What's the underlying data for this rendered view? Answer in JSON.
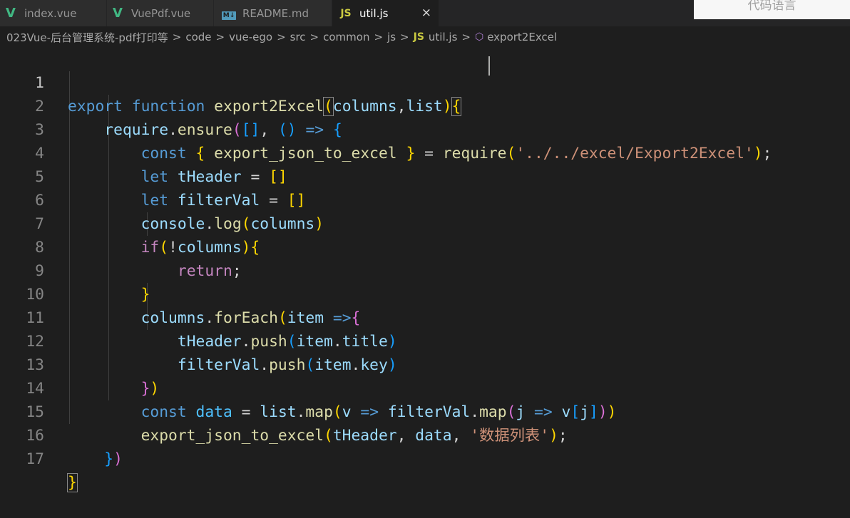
{
  "tabs": [
    {
      "label": "index.vue",
      "icon": "vue-icon",
      "active": false
    },
    {
      "label": "VuePdf.vue",
      "icon": "vue-icon",
      "active": false
    },
    {
      "label": "README.md",
      "icon": "markdown-icon",
      "active": false
    },
    {
      "label": "util.js",
      "icon": "js-icon",
      "active": true
    }
  ],
  "tab_close": "×",
  "overlay_text": "代码语言",
  "breadcrumb": {
    "items": [
      "023Vue-后台管理系统-pdf打印等",
      "code",
      "vue-ego",
      "src",
      "common",
      "js",
      "util.js",
      "export2Excel"
    ],
    "separator": ">",
    "js_badge": "JS"
  },
  "editor": {
    "line_numbers": [
      "1",
      "2",
      "3",
      "4",
      "5",
      "6",
      "7",
      "8",
      "9",
      "10",
      "11",
      "12",
      "13",
      "14",
      "15",
      "16",
      "17"
    ],
    "current_line": 1,
    "tokens": {
      "export": "export",
      "function": "function",
      "fnname": "export2Excel",
      "columns": "columns",
      "list": "list",
      "require": "require",
      "ensure": "ensure",
      "arrow": "=>",
      "const": "const",
      "export_json_to_excel": "export_json_to_excel",
      "path": "'../../excel/Export2Excel'",
      "let": "let",
      "tHeader": "tHeader",
      "filterVal": "filterVal",
      "console": "console",
      "log": "log",
      "if": "if",
      "return": "return",
      "forEach": "forEach",
      "item": "item",
      "push": "push",
      "title": "title",
      "key": "key",
      "data": "data",
      "map": "map",
      "v": "v",
      "j": "j",
      "sheet_name": "'数据列表'"
    }
  },
  "colors": {
    "background": "#1e1e1e",
    "keyword": "#569cd6",
    "control": "#c586c0",
    "function": "#dcdcaa",
    "variable": "#9cdcfe",
    "string": "#ce9178"
  }
}
